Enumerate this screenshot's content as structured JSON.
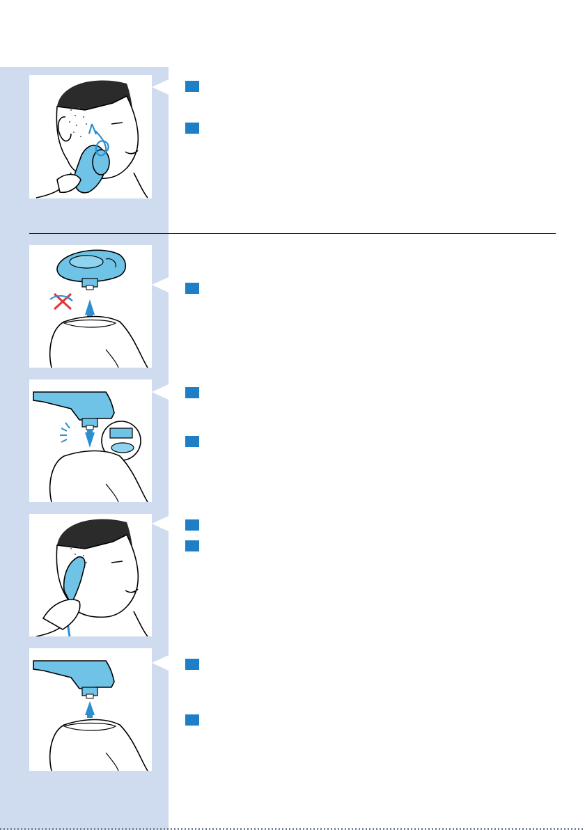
{
  "colors": {
    "sidebar": "#cfdcef",
    "marker": "#1f7fc6",
    "illustration_blue": "#6fc3e6",
    "arrow_blue": "#2a8ed1",
    "cross_red": "#e0343c"
  },
  "illustrations": [
    {
      "id": "face-shaving-circular-motion",
      "icon": "man-shaving-cheek-icon"
    },
    {
      "id": "shaving-head-removed",
      "icon": "shaving-head-detach-icon"
    },
    {
      "id": "trimmer-attached-click",
      "icon": "trimmer-attach-icon"
    },
    {
      "id": "trimming-sideburn",
      "icon": "man-trimming-sideburn-icon"
    },
    {
      "id": "trimmer-removed",
      "icon": "trimmer-detach-icon"
    }
  ],
  "step_markers": 9
}
